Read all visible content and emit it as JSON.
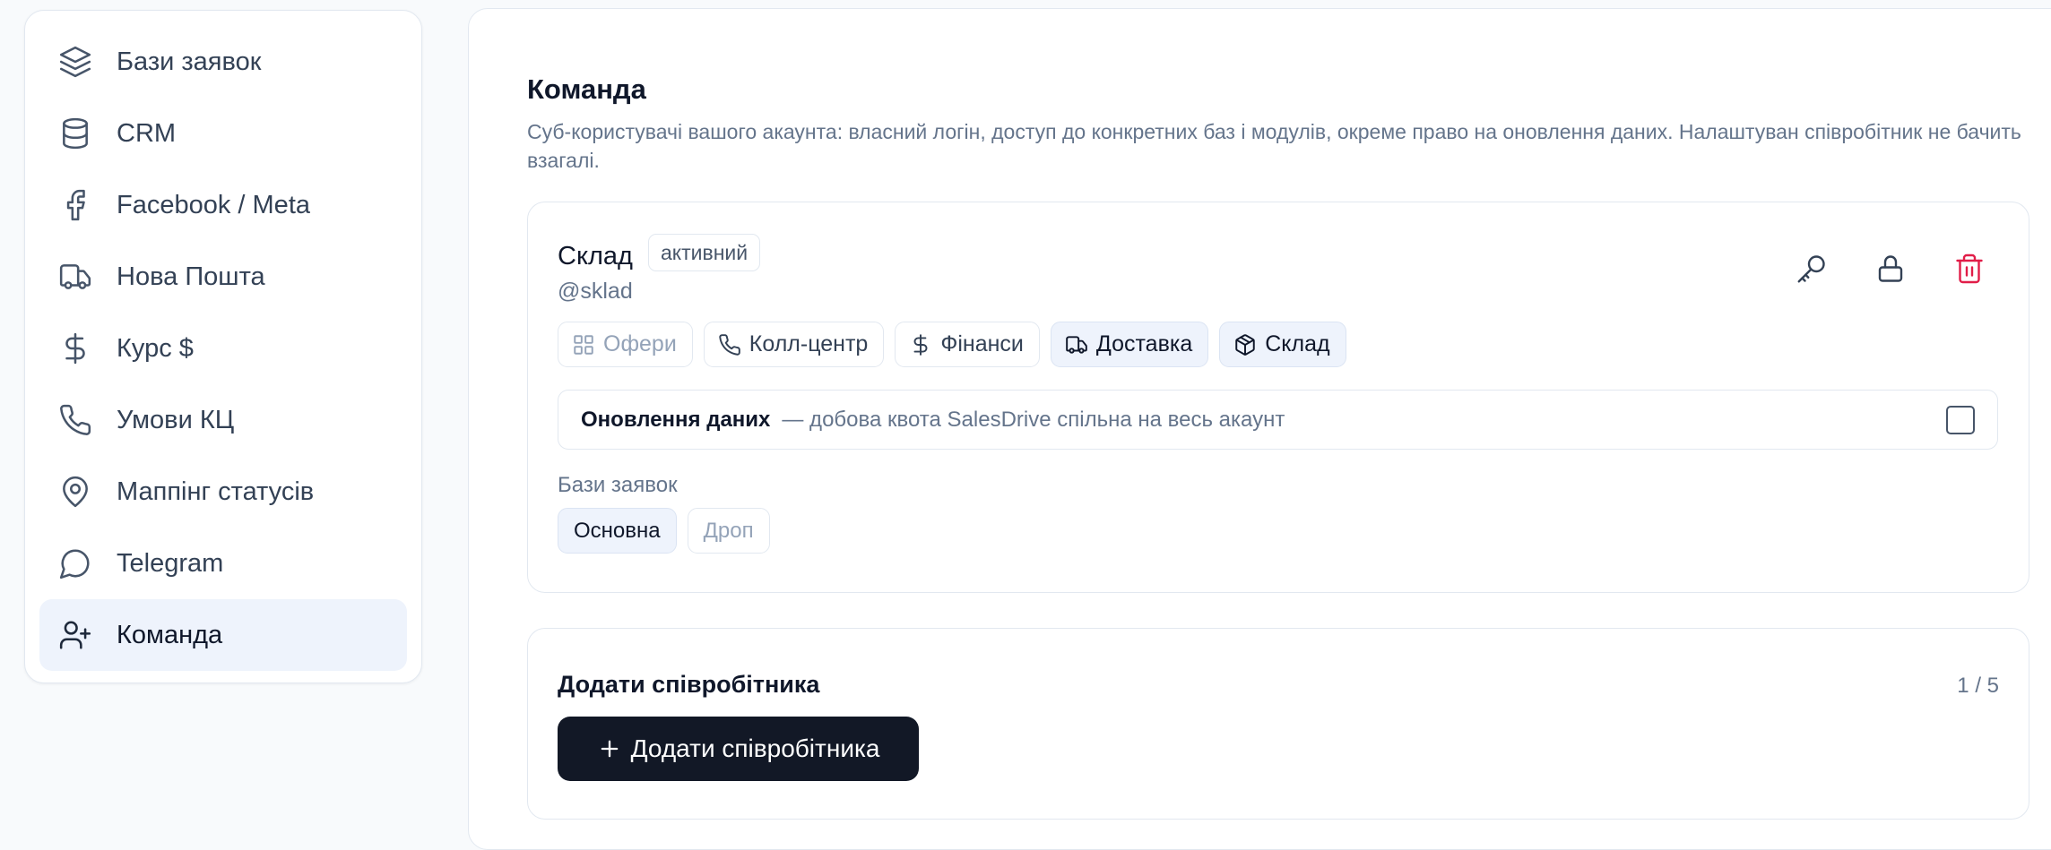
{
  "sidebar": {
    "items": [
      {
        "label": "Бази заявок",
        "icon": "layers-icon"
      },
      {
        "label": "CRM",
        "icon": "database-icon"
      },
      {
        "label": "Facebook / Meta",
        "icon": "facebook-icon"
      },
      {
        "label": "Нова Пошта",
        "icon": "truck-icon"
      },
      {
        "label": "Курс $",
        "icon": "dollar-icon"
      },
      {
        "label": "Умови КЦ",
        "icon": "phone-icon"
      },
      {
        "label": "Маппінг статусів",
        "icon": "map-pin-icon"
      },
      {
        "label": "Telegram",
        "icon": "message-circle-icon"
      },
      {
        "label": "Команда",
        "icon": "user-plus-icon",
        "active": true
      }
    ]
  },
  "main": {
    "title": "Команда",
    "description": "Суб-користувачі вашого акаунта: власний логін, доступ до конкретних баз і модулів, окреме право на оновлення даних. Налаштуван співробітник не бачить взагалі."
  },
  "member": {
    "name": "Склад",
    "status": "активний",
    "login": "@sklad",
    "actions": {
      "key": "key-icon",
      "lock": "lock-icon",
      "delete": "trash-icon"
    },
    "modules": [
      {
        "label": "Офери",
        "icon": "grid-icon",
        "enabled": false
      },
      {
        "label": "Колл-центр",
        "icon": "phone-icon",
        "enabled": false
      },
      {
        "label": "Фінанси",
        "icon": "dollar-icon",
        "enabled": false
      },
      {
        "label": "Доставка",
        "icon": "truck-icon",
        "enabled": true
      },
      {
        "label": "Склад",
        "icon": "box-icon",
        "enabled": true
      }
    ],
    "data_update": {
      "label": "Оновлення даних",
      "hint": "— добова квота SalesDrive спільна на весь акаунт",
      "checked": false
    },
    "bases_label": "Бази заявок",
    "bases": [
      {
        "label": "Основна",
        "enabled": true
      },
      {
        "label": "Дроп",
        "enabled": false
      }
    ]
  },
  "add_member": {
    "title": "Додати співробітника",
    "counter": "1 / 5",
    "button_label": "Додати співробітника"
  },
  "colors": {
    "accent_bg": "#eef3fc",
    "danger": "#e11d48",
    "button_dark": "#121826"
  }
}
